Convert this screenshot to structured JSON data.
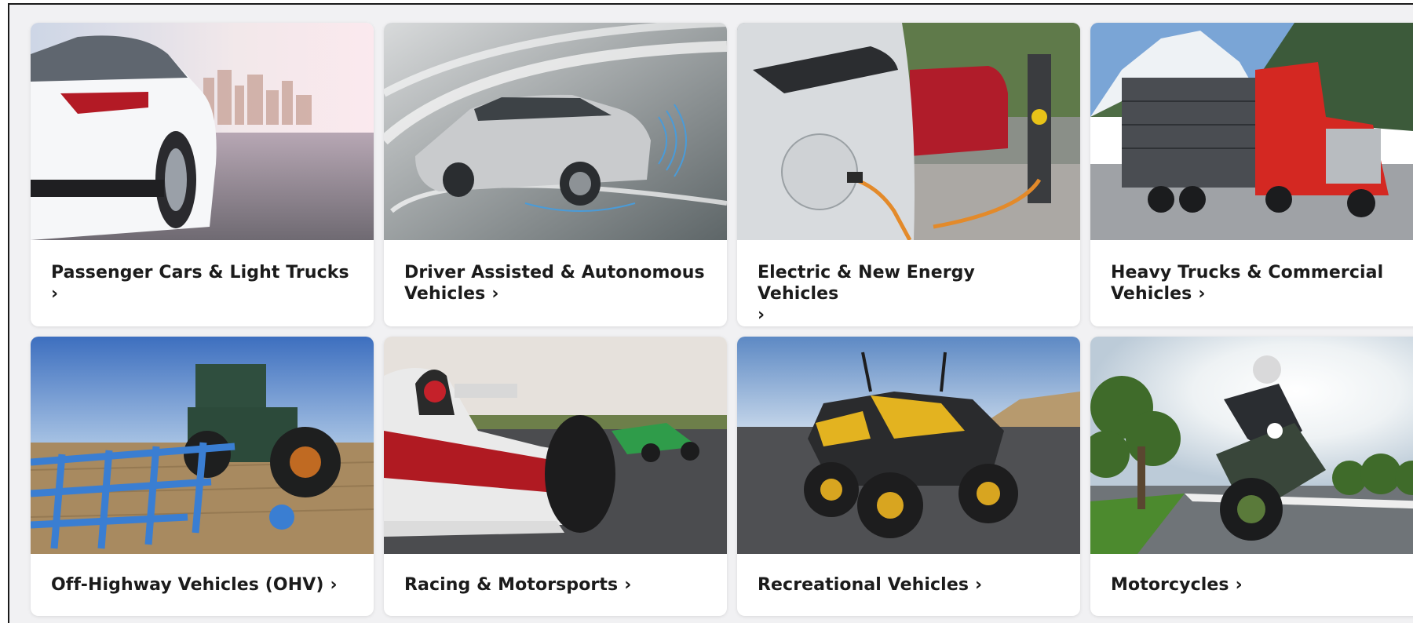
{
  "categories": [
    {
      "label": "Passenger Cars & Light Trucks",
      "chevron": "›",
      "image_icon": "passenger-car-image",
      "wrap_chevron": true
    },
    {
      "label": "Driver Assisted & Autonomous Vehicles",
      "chevron": "›",
      "image_icon": "autonomous-car-image",
      "wrap_chevron": false
    },
    {
      "label": "Electric & New Energy Vehicles",
      "chevron": "›",
      "image_icon": "electric-vehicle-image",
      "wrap_chevron": true
    },
    {
      "label": "Heavy Trucks & Commercial Vehicles",
      "chevron": "›",
      "image_icon": "heavy-truck-image",
      "wrap_chevron": false
    },
    {
      "label": "Off-Highway Vehicles (OHV)",
      "chevron": "›",
      "image_icon": "tractor-image",
      "wrap_chevron": false
    },
    {
      "label": "Racing & Motorsports",
      "chevron": "›",
      "image_icon": "race-car-image",
      "wrap_chevron": false
    },
    {
      "label": "Recreational Vehicles",
      "chevron": "›",
      "image_icon": "atv-image",
      "wrap_chevron": false
    },
    {
      "label": "Motorcycles",
      "chevron": "›",
      "image_icon": "motorcycle-image",
      "wrap_chevron": false
    }
  ],
  "colors": {
    "page_bg": "#f1f1f3",
    "card_bg": "#ffffff",
    "text": "#1b1b1b"
  }
}
